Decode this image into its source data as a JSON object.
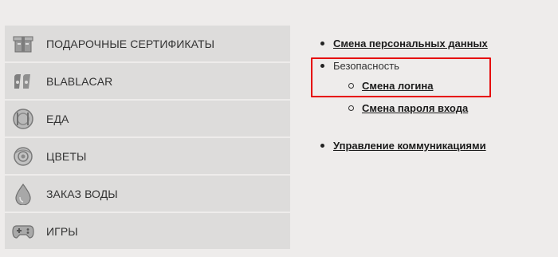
{
  "sidebar": {
    "items": [
      {
        "label": "ПОДАРОЧНЫЕ СЕРТИФИКАТЫ",
        "icon": "gift-certificate-icon"
      },
      {
        "label": "BLABLACAR",
        "icon": "blablacar-icon"
      },
      {
        "label": "ЕДА",
        "icon": "food-plate-icon"
      },
      {
        "label": "ЦВЕТЫ",
        "icon": "flower-icon"
      },
      {
        "label": "ЗАКАЗ ВОДЫ",
        "icon": "water-drop-icon"
      },
      {
        "label": "ИГРЫ",
        "icon": "gamepad-icon"
      }
    ]
  },
  "settings_menu": {
    "personal_data": "Смена персональных данных",
    "security": {
      "label": "Безопасность",
      "children": [
        "Смена логина",
        "Смена пароля входа"
      ]
    },
    "communications": "Управление коммуникациями"
  },
  "highlight": {
    "color": "#e60000"
  }
}
